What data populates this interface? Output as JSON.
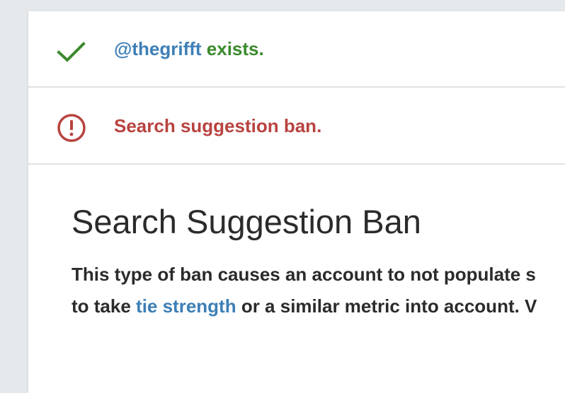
{
  "status": {
    "exists_row": {
      "icon": "checkmark-icon",
      "icon_color": "#3a8a2c",
      "handle": "@thegrifft",
      "suffix": " exists."
    },
    "ban_row": {
      "icon": "exclamation-circle-icon",
      "icon_color": "#b84340",
      "message": "Search suggestion ban."
    }
  },
  "article": {
    "heading": "Search Suggestion Ban",
    "line1": "This type of ban causes an account to not populate s",
    "line2_prefix": "to take ",
    "line2_link": "tie strength",
    "line2_suffix": " or a similar metric into account. V"
  },
  "colors": {
    "link": "#3d7fb7",
    "success": "#3a8a2c",
    "error": "#b84340",
    "background": "#e6e9ec"
  }
}
